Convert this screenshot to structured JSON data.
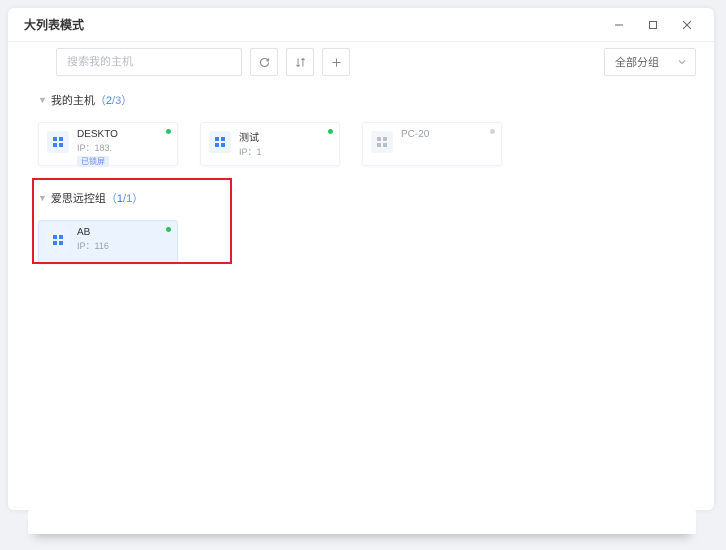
{
  "window": {
    "title": "大列表模式"
  },
  "toolbar": {
    "search_placeholder": "搜索我的主机",
    "dropdown_label": "全部分组"
  },
  "groups": [
    {
      "name": "我的主机",
      "count_online": "2",
      "count_total": "3",
      "cards": [
        {
          "name": "DESKTO",
          "ip": "IP：183.",
          "online": true,
          "badge": "已锁屏"
        },
        {
          "name": "测试",
          "ip": "IP：1",
          "online": true
        },
        {
          "name": "PC-20",
          "ip": "",
          "online": false
        }
      ]
    },
    {
      "name": "爱思远控组",
      "count_online": "1",
      "count_total": "1",
      "cards": [
        {
          "name": "AB",
          "ip": "IP：116",
          "online": true,
          "selected": true
        }
      ]
    }
  ]
}
